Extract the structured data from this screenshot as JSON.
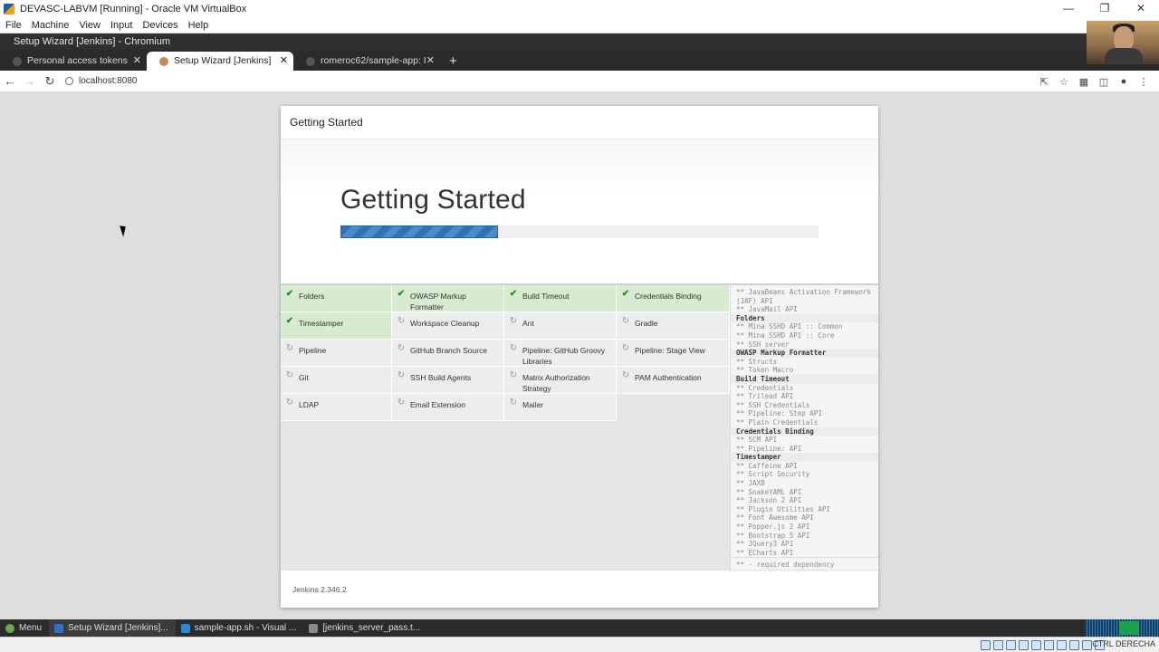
{
  "vbox": {
    "title": "DEVASC-LABVM [Running] - Oracle VM VirtualBox",
    "menu": [
      "File",
      "Machine",
      "View",
      "Input",
      "Devices",
      "Help"
    ],
    "host_key": "CTRL DERECHA"
  },
  "browser": {
    "window_title": "Setup Wizard [Jenkins] - Chromium",
    "tabs": [
      {
        "label": "Personal access tokens",
        "active": false
      },
      {
        "label": "Setup Wizard [Jenkins]",
        "active": true
      },
      {
        "label": "romeroc62/sample-app: I",
        "active": false
      }
    ],
    "url": "localhost:8080"
  },
  "dialog": {
    "header": "Getting Started",
    "title": "Getting Started",
    "progress": 0.33,
    "version": "Jenkins 2.346.2",
    "plugins": [
      {
        "name": "Folders",
        "status": "done"
      },
      {
        "name": "OWASP Markup Formatter",
        "status": "done"
      },
      {
        "name": "Build Timeout",
        "status": "done"
      },
      {
        "name": "Credentials Binding",
        "status": "done"
      },
      {
        "name": "Timestamper",
        "status": "done"
      },
      {
        "name": "Workspace Cleanup",
        "status": "pending"
      },
      {
        "name": "Ant",
        "status": "pending"
      },
      {
        "name": "Gradle",
        "status": "pending"
      },
      {
        "name": "Pipeline",
        "status": "pending"
      },
      {
        "name": "GitHub Branch Source",
        "status": "pending"
      },
      {
        "name": "Pipeline: GitHub Groovy Libraries",
        "status": "pending"
      },
      {
        "name": "Pipeline: Stage View",
        "status": "pending"
      },
      {
        "name": "Git",
        "status": "pending"
      },
      {
        "name": "SSH Build Agents",
        "status": "pending"
      },
      {
        "name": "Matrix Authorization Strategy",
        "status": "pending"
      },
      {
        "name": "PAM Authentication",
        "status": "pending"
      },
      {
        "name": "LDAP",
        "status": "pending"
      },
      {
        "name": "Email Extension",
        "status": "pending"
      },
      {
        "name": "Mailer",
        "status": "pending"
      }
    ],
    "deps": [
      {
        "t": "** JavaBeans Activation Framework (JAF) API",
        "h": false
      },
      {
        "t": "** JavaMail API",
        "h": false
      },
      {
        "t": "Folders",
        "h": true
      },
      {
        "t": "** Mina SSHD API :: Common",
        "h": false
      },
      {
        "t": "** Mina SSHD API :: Core",
        "h": false
      },
      {
        "t": "** SSH server",
        "h": false
      },
      {
        "t": "OWASP Markup Formatter",
        "h": true
      },
      {
        "t": "** Structs",
        "h": false
      },
      {
        "t": "** Token Macro",
        "h": false
      },
      {
        "t": "Build Timeout",
        "h": true
      },
      {
        "t": "** Credentials",
        "h": false
      },
      {
        "t": "** Trilead API",
        "h": false
      },
      {
        "t": "** SSH Credentials",
        "h": false
      },
      {
        "t": "** Pipeline: Step API",
        "h": false
      },
      {
        "t": "** Plain Credentials",
        "h": false
      },
      {
        "t": "Credentials Binding",
        "h": true
      },
      {
        "t": "** SCM API",
        "h": false
      },
      {
        "t": "** Pipeline: API",
        "h": false
      },
      {
        "t": "Timestamper",
        "h": true
      },
      {
        "t": "** Caffeine API",
        "h": false
      },
      {
        "t": "** Script Security",
        "h": false
      },
      {
        "t": "** JAXB",
        "h": false
      },
      {
        "t": "** SnakeYAML API",
        "h": false
      },
      {
        "t": "** Jackson 2 API",
        "h": false
      },
      {
        "t": "** Plugin Utilities API",
        "h": false
      },
      {
        "t": "** Font Awesome API",
        "h": false
      },
      {
        "t": "** Popper.js 2 API",
        "h": false
      },
      {
        "t": "** Bootstrap 5 API",
        "h": false
      },
      {
        "t": "** JQuery3 API",
        "h": false
      },
      {
        "t": "** ECharts API",
        "h": false
      }
    ],
    "deps_footer": "** - required dependency"
  },
  "taskbar": {
    "menu": "Menu",
    "items": [
      {
        "label": "Setup Wizard [Jenkins]...",
        "color": "#2f6fd1",
        "active": true
      },
      {
        "label": "sample-app.sh - Visual ...",
        "color": "#2a8ad8",
        "active": false
      },
      {
        "label": "[jenkins_server_pass.t...",
        "color": "#8a8a8a",
        "active": false
      }
    ]
  }
}
